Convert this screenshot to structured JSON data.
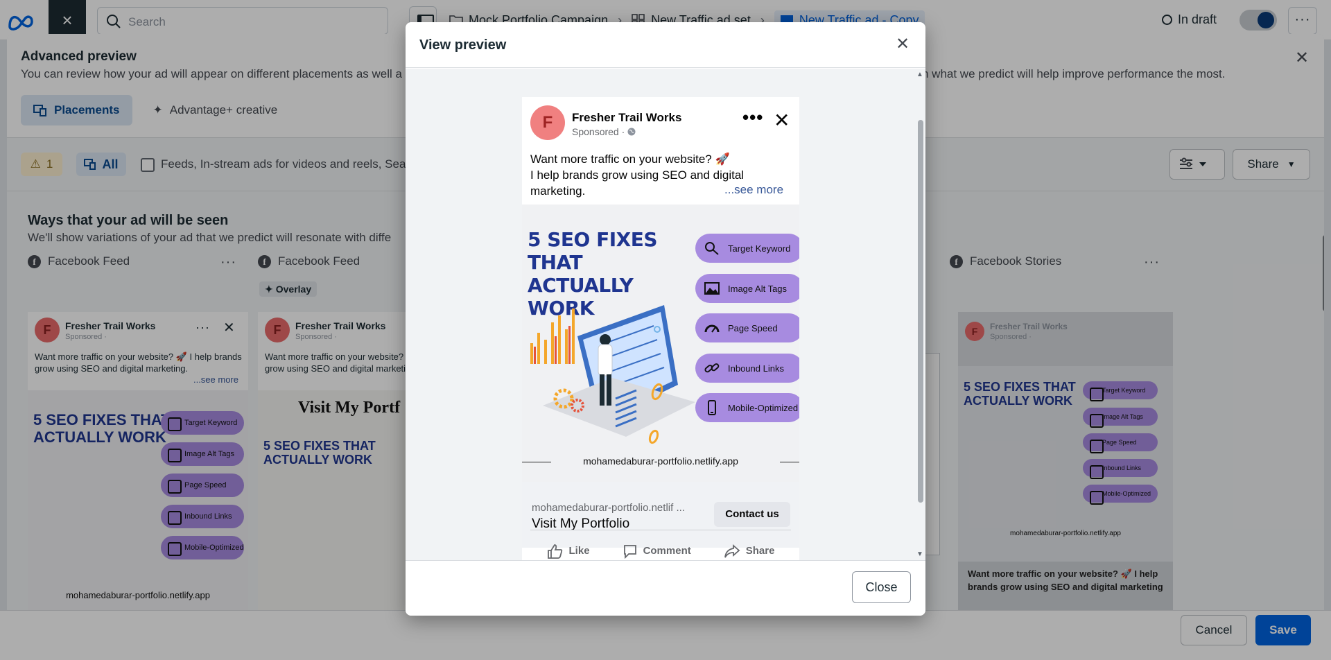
{
  "topbar": {
    "search_placeholder": "Search",
    "breadcrumbs": [
      "Mock Portfolio Campaign",
      "New Traffic ad set",
      "New Traffic ad - Copy"
    ],
    "status": "In draft"
  },
  "advanced_preview": {
    "title": "Advanced preview",
    "description_left": "You can review how your ad will appear on different placements as well a",
    "description_right": "n what we predict will help improve performance the most.",
    "tabs": [
      {
        "label": "Placements",
        "active": true
      },
      {
        "label": "Advantage+ creative",
        "active": false
      }
    ],
    "filters": {
      "warning_count": "1",
      "all_label": "All",
      "checkbox_label": "Feeds, In-stream ads for videos and reels, Sear"
    },
    "share_label": "Share",
    "ways_title": "Ways that your ad will be seen",
    "ways_desc": "We'll show variations of your ad that we predict will resonate with diffe",
    "placements": [
      {
        "label": "Facebook Feed"
      },
      {
        "label": "Facebook Feed",
        "chip": "Overlay"
      },
      {
        "label": "Facebook Stories"
      }
    ],
    "second_card_overlay_text": "Visit My Portf",
    "cancel_label": "Cancel",
    "save_label": "Save"
  },
  "modal": {
    "title": "View preview",
    "close_label": "Close"
  },
  "ad": {
    "page_name": "Fresher Trail Works",
    "avatar_letter": "F",
    "sponsored": "Sponsored ·",
    "primary_text_line1": "Want more traffic on your website? 🚀",
    "primary_text_line2": "I help brands grow using SEO and digital",
    "primary_text_line3": "marketing.",
    "see_more": "...see more",
    "creative": {
      "headline": "5 SEO FIXES THAT ACTUALLY WORK",
      "pills": [
        "Target Keyword",
        "Image Alt Tags",
        "Page Speed",
        "Inbound Links",
        "Mobile-Optimized"
      ],
      "url": "mohamedaburar-portfolio.netlify.app",
      "accent_color": "#a78be0",
      "headline_color": "#1f3590"
    },
    "link_domain": "mohamedaburar-portfolio.netlif ...",
    "link_title": "Visit My Portfolio",
    "cta": "Contact us",
    "actions": [
      "Like",
      "Comment",
      "Share"
    ]
  },
  "mini_card": {
    "primary_text": "Want more traffic on your website? 🚀 I help brands grow using SEO and digital marketing.",
    "stories_text": "Want more traffic on your website? 🚀 I help brands grow using SEO and digital marketing"
  },
  "icons": {
    "logo": "meta-logo-icon",
    "close": "close-icon",
    "search": "search-icon",
    "warning": "warning-icon",
    "facebook": "facebook-icon",
    "globe": "globe-icon"
  }
}
